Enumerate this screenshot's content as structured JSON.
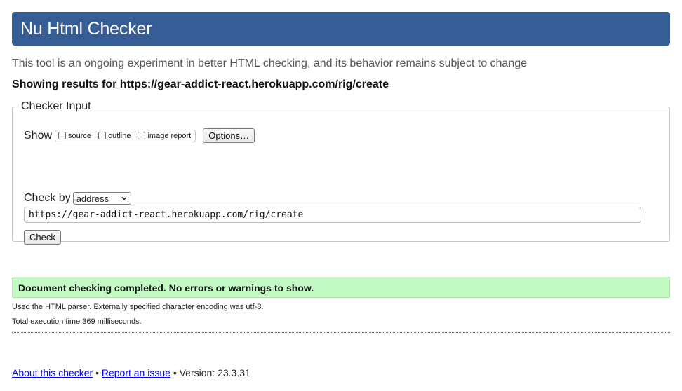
{
  "header": {
    "title": "Nu Html Checker"
  },
  "tagline": "This tool is an ongoing experiment in better HTML checking, and its behavior remains subject to change",
  "showing_results": "Showing results for https://gear-addict-react.herokuapp.com/rig/create",
  "checker_input": {
    "legend": "Checker Input",
    "show_label": "Show",
    "show_options": [
      {
        "label": "source",
        "checked": false
      },
      {
        "label": "outline",
        "checked": false
      },
      {
        "label": "image report",
        "checked": false
      }
    ],
    "options_button": "Options…",
    "check_by_label": "Check by",
    "check_by_selected": "address",
    "url_value": "https://gear-addict-react.herokuapp.com/rig/create",
    "check_button": "Check"
  },
  "result": {
    "message": "Document checking completed. No errors or warnings to show.",
    "color": "#c4fac4"
  },
  "info": {
    "parser": "Used the HTML parser. Externally specified character encoding was utf-8.",
    "execution_time": "Total execution time 369 milliseconds."
  },
  "footer": {
    "about_link": "About this checker",
    "separator": "•",
    "report_link": "Report an issue",
    "version": "Version: 23.3.31"
  },
  "colors": {
    "header_bg": "#365d95",
    "link": "#0000ee"
  }
}
